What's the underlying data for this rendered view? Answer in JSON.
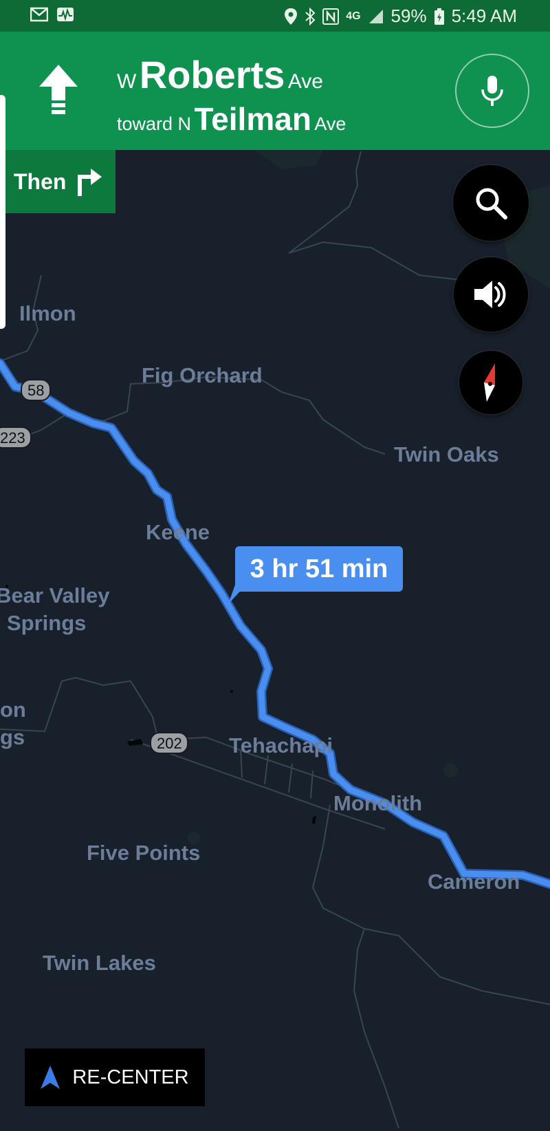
{
  "status_bar": {
    "icons_left": [
      "mail-icon",
      "activity-icon"
    ],
    "icons_right": [
      "location-icon",
      "bluetooth-icon",
      "nfc-icon",
      "lte-icon",
      "signal-icon",
      "battery-icon"
    ],
    "network": "4G",
    "battery": "59%",
    "time": "5:49 AM"
  },
  "navigation": {
    "direction_icon": "straight-arrow-icon",
    "street_prefix": "W",
    "street_name": "Roberts",
    "street_suffix": "Ave",
    "toward_label": "toward N",
    "toward_name": "Teilman",
    "toward_suffix": "Ave",
    "mic_icon": "microphone-icon"
  },
  "next_step": {
    "label": "Then",
    "icon": "turn-right-icon"
  },
  "map": {
    "places": [
      "Ilmon",
      "Fig Orchard",
      "Twin Oaks",
      "Keene",
      "Bear Valley",
      "Springs",
      "on",
      "gs",
      "Tehachapi",
      "Monolith",
      "Five Points",
      "Cameron",
      "Twin Lakes"
    ],
    "route_shields": [
      "58",
      "223",
      "202"
    ],
    "eta": "3 hr 51 min",
    "route_color": "#4a8ff0",
    "background_color": "#18202b"
  },
  "controls": {
    "search_icon": "search-icon",
    "sound_icon": "speaker-icon",
    "compass_icon": "compass-icon",
    "recenter_label": "RE-CENTER"
  }
}
